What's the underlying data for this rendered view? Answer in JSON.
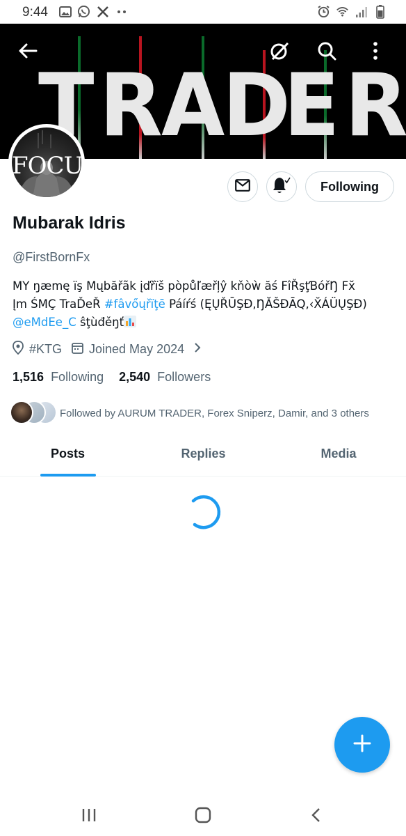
{
  "status_bar": {
    "time": "9:44",
    "left_icons": [
      "gallery-icon",
      "whatsapp-icon",
      "x-icon",
      "more-dots-icon"
    ],
    "right_icons": [
      "alarm-icon",
      "wifi-icon",
      "signal-icon",
      "battery-icon"
    ]
  },
  "banner": {
    "text": "TRADER",
    "letters": [
      "T",
      "R",
      "A",
      "D",
      "E",
      "R"
    ],
    "nav_icons": [
      "back-arrow-icon",
      "grok-icon",
      "search-icon",
      "more-vertical-icon"
    ]
  },
  "avatar": {
    "text": "FOCUS"
  },
  "actions": {
    "message_icon": "mail-icon",
    "notify_icon": "bell-check-icon",
    "follow_label": "Following"
  },
  "profile": {
    "name": "Mubarak Idris",
    "handle": "@FirstBornFx",
    "bio": {
      "line1": "MY ŋæmę ïş Mųbăřãk įďřïš  pòpůľæřļŷ kňòẁ ăś  FîŘşţƁóřŊ Fx̆",
      "line2_start": "Įm  ŚMÇ TraĎeŘ ",
      "line2_tag": "#fâvőųřïţē",
      "line2_end": " Páíŕś (ĘŲŘŪŞĐ,ŊĂŠĐĀQ,‹X̆ÁÜŲŞĐ)",
      "line3_mention": "@eMdEe_C",
      "line3_end": " ŝţùđěŋť"
    },
    "location": "#KTG",
    "joined": "Joined May 2024",
    "following_count": "1,516",
    "following_label": "Following",
    "followers_count": "2,540",
    "followers_label": "Followers",
    "followed_by": "Followed by AURUM TRADER, Forex Sniperz, Damir, and 3 others"
  },
  "tabs": [
    {
      "label": "Posts",
      "active": true
    },
    {
      "label": "Replies",
      "active": false
    },
    {
      "label": "Media",
      "active": false
    }
  ],
  "fab": {
    "icon": "plus-icon"
  },
  "android_nav": [
    "recents-icon",
    "home-icon",
    "back-icon"
  ],
  "colors": {
    "accent": "#1d9bf0",
    "text_primary": "#0f1419",
    "text_secondary": "#536471",
    "banner_bg": "#000000"
  }
}
